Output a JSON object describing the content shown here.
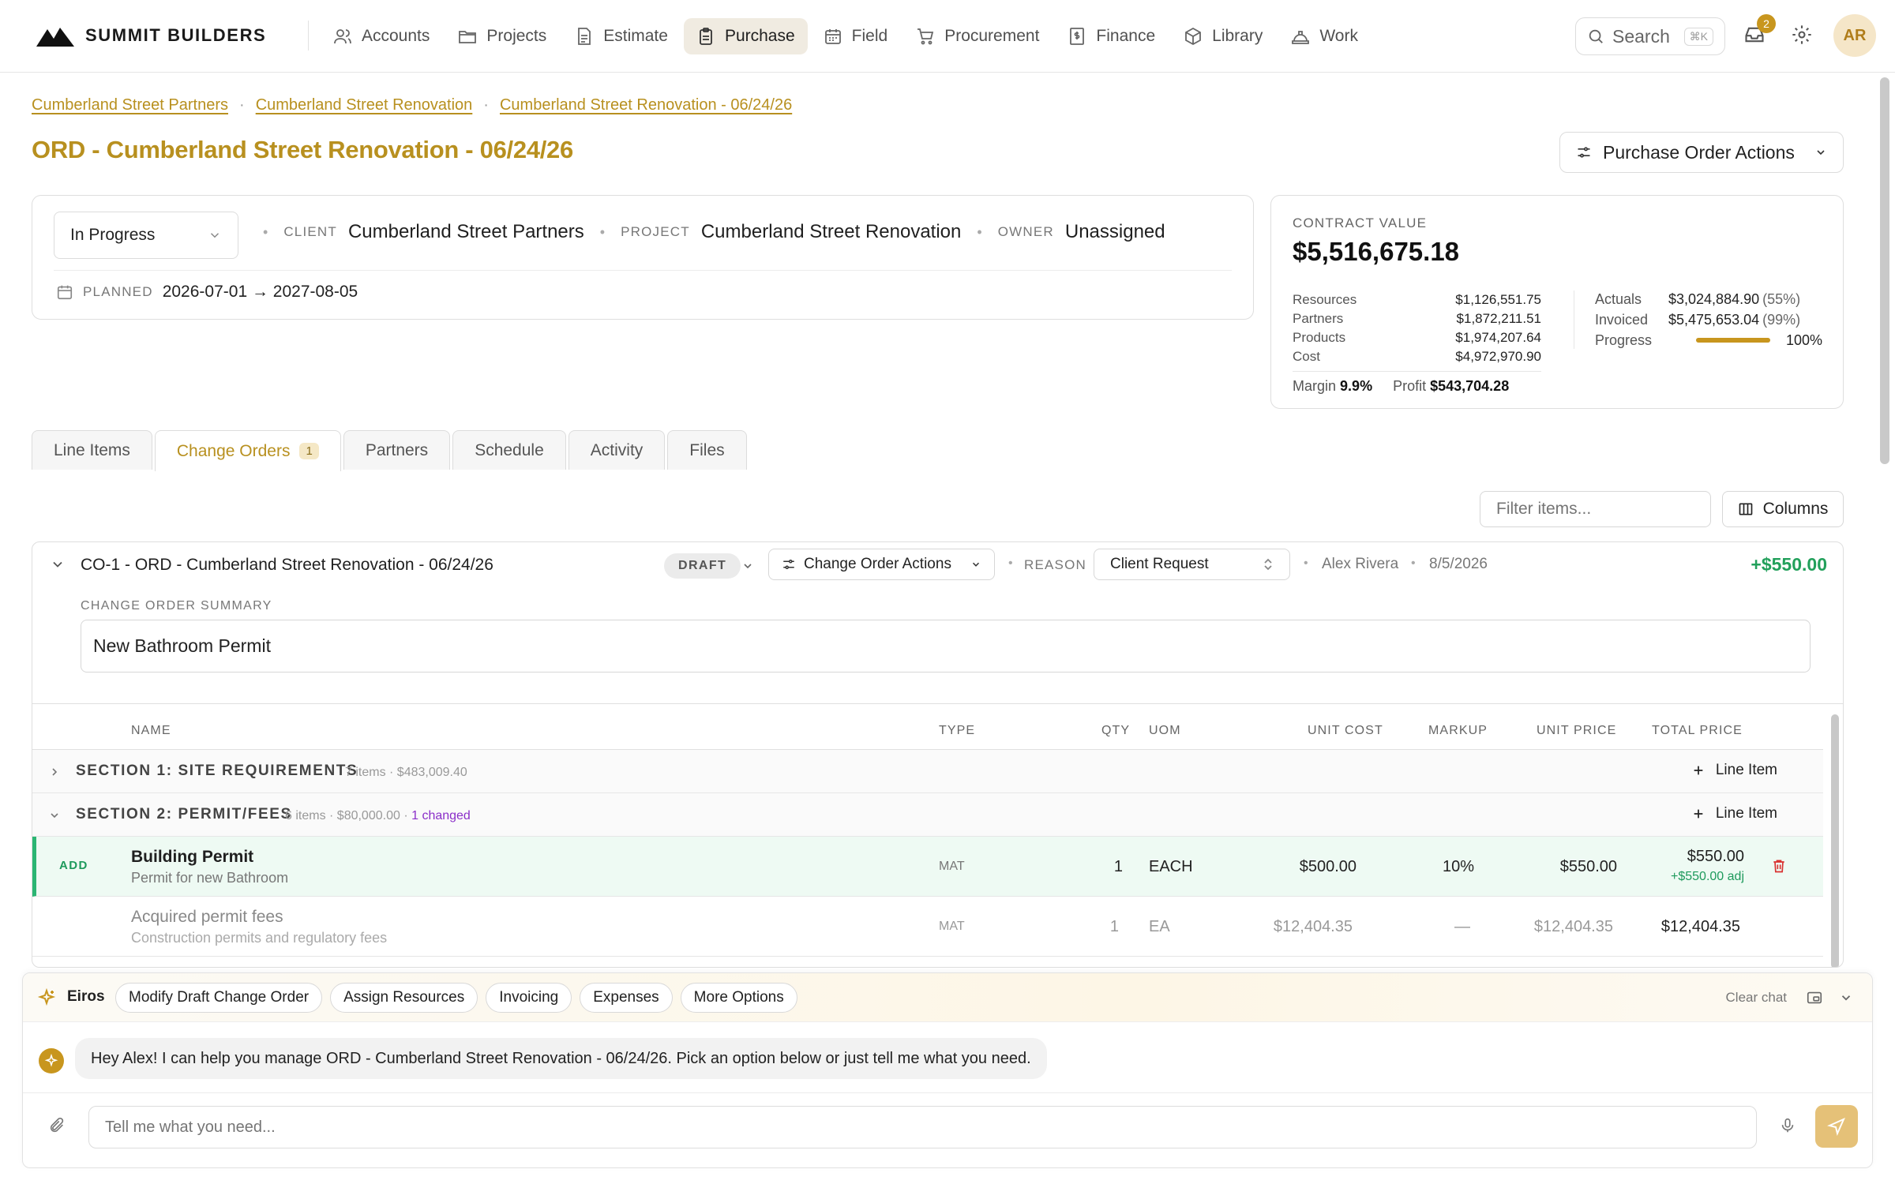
{
  "brand": {
    "name": "SUMMIT BUILDERS",
    "logo_icon": "mountain-logo"
  },
  "nav": [
    {
      "label": "Accounts",
      "icon": "users-icon",
      "active": false
    },
    {
      "label": "Projects",
      "icon": "folder-icon",
      "active": false
    },
    {
      "label": "Estimate",
      "icon": "document-icon",
      "active": false
    },
    {
      "label": "Purchase",
      "icon": "clipboard-icon",
      "active": true
    },
    {
      "label": "Field",
      "icon": "calendar-icon",
      "active": false
    },
    {
      "label": "Procurement",
      "icon": "cart-icon",
      "active": false
    },
    {
      "label": "Finance",
      "icon": "dollar-doc-icon",
      "active": false
    },
    {
      "label": "Library",
      "icon": "box-icon",
      "active": false
    },
    {
      "label": "Work",
      "icon": "hard-hat-icon",
      "active": false
    }
  ],
  "search": {
    "label": "Search",
    "shortcut": "⌘K"
  },
  "notifications": {
    "count": "2"
  },
  "user": {
    "initials": "AR"
  },
  "breadcrumbs": [
    "Cumberland Street Partners",
    "Cumberland Street Renovation",
    "Cumberland Street Renovation - 06/24/26"
  ],
  "page_title": "ORD - Cumberland Street Renovation - 06/24/26",
  "po_actions_label": "Purchase Order Actions",
  "info": {
    "status": "In Progress",
    "client_label": "CLIENT",
    "client": "Cumberland Street Partners",
    "project_label": "PROJECT",
    "project": "Cumberland Street Renovation",
    "owner_label": "OWNER",
    "owner": "Unassigned",
    "planned_label": "PLANNED",
    "planned": "2026-07-01 → 2027-08-05"
  },
  "contract": {
    "label": "CONTRACT VALUE",
    "value": "$5,516,675.18",
    "breakdown": [
      {
        "label": "Resources",
        "value": "$1,126,551.75"
      },
      {
        "label": "Partners",
        "value": "$1,872,211.51"
      },
      {
        "label": "Products",
        "value": "$1,974,207.64"
      },
      {
        "label": "Cost",
        "value": "$4,972,970.90"
      }
    ],
    "margin_label": "Margin",
    "margin": "9.9%",
    "profit_label": "Profit",
    "profit": "$543,704.28",
    "actuals_label": "Actuals",
    "actuals": "$3,024,884.90",
    "actuals_pct": "(55%)",
    "invoiced_label": "Invoiced",
    "invoiced": "$5,475,653.04",
    "invoiced_pct": "(99%)",
    "progress_label": "Progress",
    "progress_text": "100%",
    "progress_fraction": 1.0
  },
  "tabs": [
    {
      "label": "Line Items",
      "active": false
    },
    {
      "label": "Change Orders",
      "active": true,
      "count": "1"
    },
    {
      "label": "Partners",
      "active": false
    },
    {
      "label": "Schedule",
      "active": false
    },
    {
      "label": "Activity",
      "active": false
    },
    {
      "label": "Files",
      "active": false
    }
  ],
  "filter_placeholder": "Filter items...",
  "columns_label": "Columns",
  "change_order": {
    "title": "CO-1 - ORD - Cumberland Street Renovation - 06/24/26",
    "status": "DRAFT",
    "actions_label": "Change Order Actions",
    "reason_label": "REASON",
    "reason": "Client Request",
    "author": "Alex Rivera",
    "date": "8/5/2026",
    "amount": "+$550.00",
    "summary_label": "CHANGE ORDER SUMMARY",
    "summary": "New Bathroom Permit"
  },
  "table": {
    "headers": {
      "name": "NAME",
      "type": "TYPE",
      "qty": "QTY",
      "uom": "UOM",
      "unit_cost": "UNIT COST",
      "markup": "MARKUP",
      "unit_price": "UNIT PRICE",
      "total_price": "TOTAL PRICE"
    },
    "add_line_label": "Line Item",
    "sections": [
      {
        "title": "SECTION 1: SITE REQUIREMENTS",
        "meta": "7 items · $483,009.40",
        "changed": ""
      },
      {
        "title": "SECTION 2: PERMIT/FEES",
        "meta": "6 items · $80,000.00 · ",
        "changed": "1 changed"
      }
    ],
    "rows": [
      {
        "tag": "ADD",
        "name": "Building Permit",
        "desc": "Permit for new Bathroom",
        "type": "MAT",
        "qty": "1",
        "uom": "EACH",
        "unit_cost": "$500.00",
        "markup": "10%",
        "unit_price": "$550.00",
        "total": "$550.00",
        "adj": "+$550.00 adj"
      },
      {
        "tag": "",
        "name": "Acquired permit fees",
        "desc": "Construction permits and regulatory fees",
        "type": "MAT",
        "qty": "1",
        "uom": "EA",
        "unit_cost": "$12,404.35",
        "markup": "—",
        "unit_price": "$12,404.35",
        "total": "$12,404.35",
        "adj": ""
      }
    ]
  },
  "assistant": {
    "name": "Eiros",
    "chips": [
      "Modify Draft Change Order",
      "Assign Resources",
      "Invoicing",
      "Expenses",
      "More Options"
    ],
    "clear_label": "Clear chat",
    "message": "Hey Alex! I can help you manage ORD - Cumberland Street Renovation - 06/24/26. Pick an option below or just tell me what you need.",
    "input_placeholder": "Tell me what you need..."
  },
  "colors": {
    "accent": "#b8901f",
    "accent_fill": "#c8961e",
    "success": "#22a05b",
    "danger": "#d9302f",
    "changed": "#8b2fc9"
  }
}
